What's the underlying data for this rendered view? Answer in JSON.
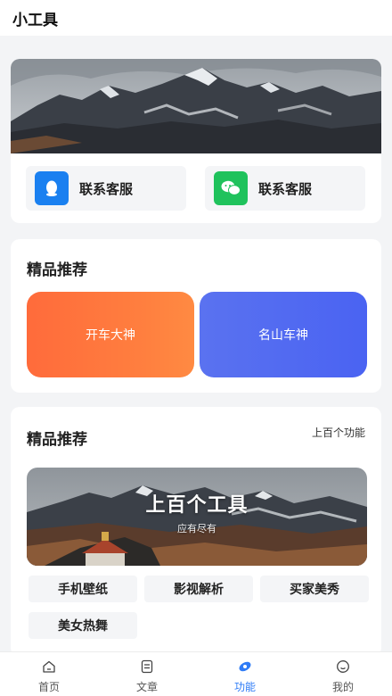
{
  "header": {
    "title": "小工具"
  },
  "contacts": [
    {
      "label": "联系客服",
      "icon": "qq-penguin-icon",
      "color": "#1a80f0"
    },
    {
      "label": "联系客服",
      "icon": "wechat-icon",
      "color": "#1fc25c"
    }
  ],
  "section1": {
    "title": "精品推荐",
    "promos": [
      {
        "label": "开车大神",
        "color": "#ff7b3d"
      },
      {
        "label": "名山车神",
        "color": "#4f68f2"
      }
    ]
  },
  "section2": {
    "title": "精品推荐",
    "more": "上百个功能",
    "hero_title": "上百个工具",
    "hero_subtitle": "应有尽有",
    "tags": [
      "手机壁纸",
      "影视解析",
      "买家美秀",
      "美女热舞"
    ]
  },
  "tabbar": {
    "active_color": "#2f7cf6",
    "items": [
      {
        "label": "首页",
        "icon": "home-icon"
      },
      {
        "label": "文章",
        "icon": "article-icon"
      },
      {
        "label": "功能",
        "icon": "feature-icon"
      },
      {
        "label": "我的",
        "icon": "profile-icon"
      }
    ]
  }
}
